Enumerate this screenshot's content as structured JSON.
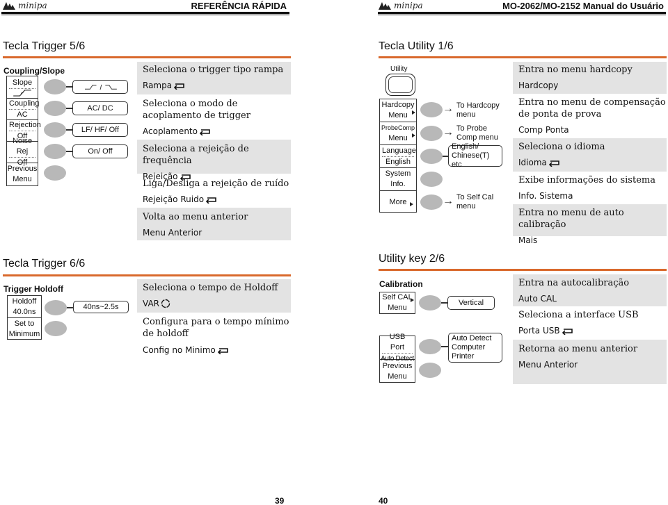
{
  "header": {
    "left": {
      "brand": "minipa",
      "title": "REFERÊNCIA RÁPIDA"
    },
    "right": {
      "brand": "minipa",
      "title": "MO-2062/MO-2152 Manual do Usuário"
    }
  },
  "trigger56": {
    "title": "Tecla Trigger 5/6",
    "panel_title": "Coupling/Slope",
    "menu": [
      {
        "l1": "Slope",
        "l2": "",
        "icon": "slope-icon"
      },
      {
        "l1": "Coupling",
        "l2": "AC"
      },
      {
        "l1": "Rejection",
        "l2": "Off"
      },
      {
        "l1": "Noise Rej",
        "l2": "Off"
      },
      {
        "l1": "Previous",
        "l2": "Menu"
      }
    ],
    "options": [
      "rising / falling",
      "AC/ DC",
      "LF/ HF/ Off",
      "On/ Off"
    ],
    "descriptions": [
      {
        "main": "Seleciona o trigger tipo rampa",
        "sub": "Rampa",
        "icon": "enter-icon"
      },
      {
        "main": "Seleciona o modo de acoplamento de trigger",
        "sub": "Acoplamento",
        "icon": "enter-icon"
      },
      {
        "main": "Seleciona a rejeição de frequência",
        "sub": "Rejeição",
        "icon": "enter-icon"
      },
      {
        "main": "Liga/Desliga a rejeição de ruído",
        "sub": "Rejeição Ruido",
        "icon": "enter-icon"
      },
      {
        "main": "Volta ao menu anterior",
        "sub": "Menu Anterior",
        "icon": ""
      }
    ]
  },
  "trigger66": {
    "title": "Tecla Trigger 6/6",
    "panel_title": "Trigger Holdoff",
    "menu": [
      {
        "l1": "Holdoff",
        "l2": "40.0ns"
      },
      {
        "l1": "Set to",
        "l2": "Minimum"
      }
    ],
    "options": [
      "40ns~2.5s"
    ],
    "descriptions": [
      {
        "main": "Seleciona o tempo de Holdoff",
        "sub": "VAR",
        "icon": "var-knob-icon"
      },
      {
        "main": "Configura para o tempo mínimo de holdoff",
        "sub": "Config no Minimo",
        "icon": "enter-icon"
      }
    ]
  },
  "utility16": {
    "title": "Tecla Utility 1/6",
    "key_label": "Utility",
    "menu": [
      {
        "l1": "Hardcopy",
        "l2": "Menu",
        "arrow": true
      },
      {
        "l1": "ProbeComp",
        "l2": "Menu",
        "arrow": true
      },
      {
        "l1": "Language",
        "l2": "English"
      },
      {
        "l1": "System",
        "l2": "Info."
      },
      {
        "l1": "More",
        "l2": "",
        "arrow": true
      }
    ],
    "destinations": [
      "To Hardcopy menu",
      "To Probe Comp menu",
      "To Self Cal menu"
    ],
    "options": [
      "English/ Chinese(T) etc"
    ],
    "descriptions": [
      {
        "main": "Entra no menu hardcopy",
        "sub": "Hardcopy",
        "icon": ""
      },
      {
        "main": "Entra no menu de compensação de ponta de prova",
        "sub": "Comp Ponta",
        "icon": ""
      },
      {
        "main": "Seleciona o idioma",
        "sub": "Idioma",
        "icon": "enter-icon"
      },
      {
        "main": "Exibe informações do sistema",
        "sub": "Info. Sistema",
        "icon": ""
      },
      {
        "main": "Entra no menu de auto calibração",
        "sub": "Mais",
        "icon": ""
      }
    ]
  },
  "utility26": {
    "title": "Utility key 2/6",
    "panel_title": "Calibration",
    "menu": [
      {
        "l1": "Self CAL",
        "l2": "Menu",
        "arrow": true
      },
      {
        "l1": "USB Port",
        "l2": "Auto Detect"
      },
      {
        "l1": "Previous",
        "l2": "Menu"
      }
    ],
    "options": [
      "Vertical",
      "Auto Detect Computer Printer"
    ],
    "descriptions": [
      {
        "main": "Entra na autocalibração",
        "sub": "Auto CAL",
        "icon": ""
      },
      {
        "main": "Seleciona a interface USB",
        "sub": "Porta USB",
        "icon": "enter-icon"
      },
      {
        "main": "Retorna ao menu anterior",
        "sub": "Menu Anterior",
        "icon": ""
      }
    ]
  },
  "pages": {
    "left": "39",
    "right": "40"
  }
}
